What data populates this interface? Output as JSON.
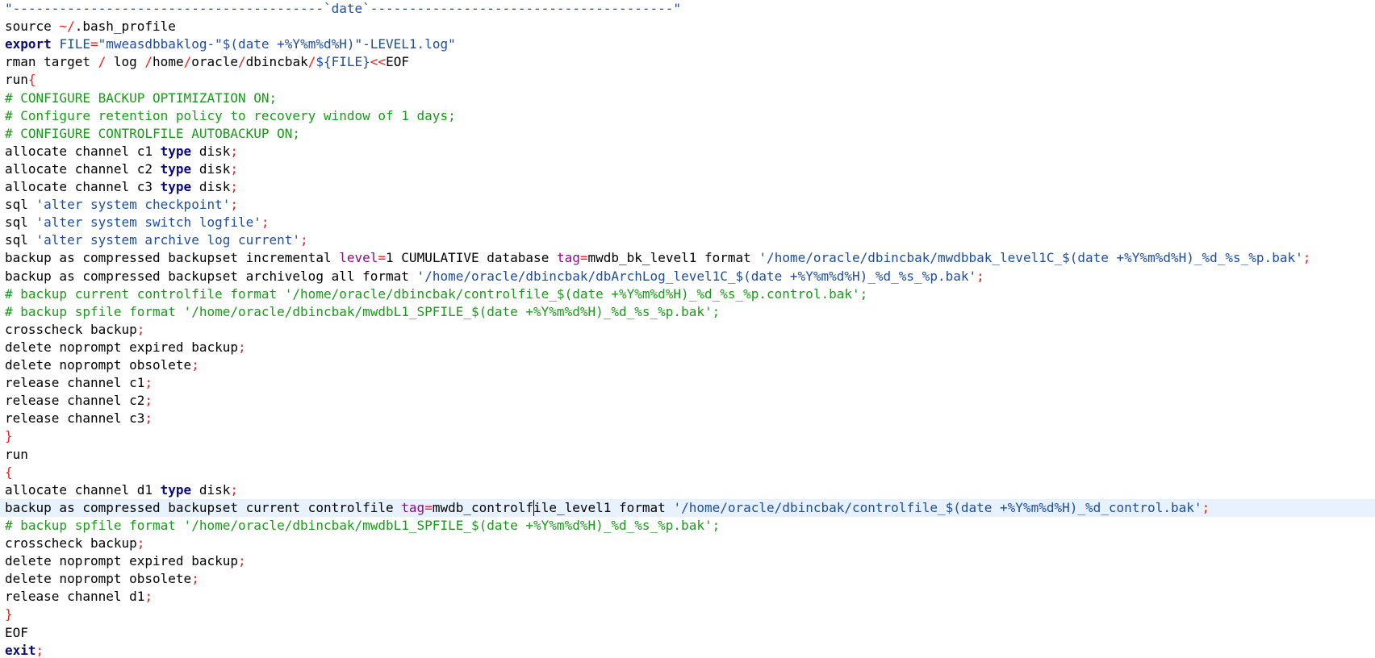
{
  "editor": {
    "colors": {
      "plain": "#000000",
      "operator": "#e8201b",
      "string": "#1d4e9e",
      "keyword": "#0a0a7a",
      "comment": "#1a9a1a",
      "attribute": "#8b0a8b",
      "current_line_bg": "#e8f2fe"
    },
    "current_line_index": 28,
    "lines": [
      [
        [
          "str",
          "\"----------------------------------------`date`---------------------------------------\""
        ]
      ],
      [
        [
          "plain",
          "source "
        ],
        [
          "op",
          "~/"
        ],
        [
          "plain",
          ".bash_profile"
        ]
      ],
      [
        [
          "kw",
          "export"
        ],
        [
          "plain",
          " "
        ],
        [
          "var",
          "FILE"
        ],
        [
          "op",
          "="
        ],
        [
          "str",
          "\"mweasdbbaklog-\"$(date +%Y%m%d%H)\"-LEVEL1.log\""
        ]
      ],
      [
        [
          "plain",
          "rman target "
        ],
        [
          "op",
          "/"
        ],
        [
          "plain",
          " log "
        ],
        [
          "op",
          "/"
        ],
        [
          "plain",
          "home"
        ],
        [
          "op",
          "/"
        ],
        [
          "plain",
          "oracle"
        ],
        [
          "op",
          "/"
        ],
        [
          "plain",
          "dbincbak"
        ],
        [
          "op",
          "/"
        ],
        [
          "var",
          "${FILE}"
        ],
        [
          "op",
          "<<"
        ],
        [
          "plain",
          "EOF"
        ]
      ],
      [
        [
          "plain",
          "run"
        ],
        [
          "op",
          "{"
        ]
      ],
      [
        [
          "cmt",
          "# CONFIGURE BACKUP OPTIMIZATION ON;"
        ]
      ],
      [
        [
          "cmt",
          "# Configure retention policy to recovery window of 1 days;"
        ]
      ],
      [
        [
          "cmt",
          "# CONFIGURE CONTROLFILE AUTOBACKUP ON;"
        ]
      ],
      [
        [
          "plain",
          "allocate channel c1 "
        ],
        [
          "kw",
          "type"
        ],
        [
          "plain",
          " disk"
        ],
        [
          "op",
          ";"
        ]
      ],
      [
        [
          "plain",
          "allocate channel c2 "
        ],
        [
          "kw",
          "type"
        ],
        [
          "plain",
          " disk"
        ],
        [
          "op",
          ";"
        ]
      ],
      [
        [
          "plain",
          "allocate channel c3 "
        ],
        [
          "kw",
          "type"
        ],
        [
          "plain",
          " disk"
        ],
        [
          "op",
          ";"
        ]
      ],
      [
        [
          "plain",
          "sql "
        ],
        [
          "str",
          "'alter system checkpoint'"
        ],
        [
          "op",
          ";"
        ]
      ],
      [
        [
          "plain",
          "sql "
        ],
        [
          "str",
          "'alter system switch logfile'"
        ],
        [
          "op",
          ";"
        ]
      ],
      [
        [
          "plain",
          "sql "
        ],
        [
          "str",
          "'alter system archive log current'"
        ],
        [
          "op",
          ";"
        ]
      ],
      [
        [
          "plain",
          "backup as compressed backupset incremental "
        ],
        [
          "tagkw",
          "level"
        ],
        [
          "op",
          "="
        ],
        [
          "plain",
          "1 CUMULATIVE database "
        ],
        [
          "tagkw",
          "tag"
        ],
        [
          "op",
          "="
        ],
        [
          "plain",
          "mwdb_bk_level1 format "
        ],
        [
          "str",
          "'/home/oracle/dbincbak/mwdbbak_level1C_$(date +%Y%m%d%H)_%d_%s_%p.bak'"
        ],
        [
          "op",
          ";"
        ]
      ],
      [
        [
          "plain",
          "backup as compressed backupset archivelog all format "
        ],
        [
          "str",
          "'/home/oracle/dbincbak/dbArchLog_level1C_$(date +%Y%m%d%H)_%d_%s_%p.bak'"
        ],
        [
          "op",
          ";"
        ]
      ],
      [
        [
          "cmt",
          "# backup current controlfile format '/home/oracle/dbincbak/controlfile_$(date +%Y%m%d%H)_%d_%s_%p.control.bak';"
        ]
      ],
      [
        [
          "cmt",
          "# backup spfile format '/home/oracle/dbincbak/mwdbL1_SPFILE_$(date +%Y%m%d%H)_%d_%s_%p.bak';"
        ]
      ],
      [
        [
          "plain",
          "crosscheck backup"
        ],
        [
          "op",
          ";"
        ]
      ],
      [
        [
          "plain",
          "delete noprompt expired backup"
        ],
        [
          "op",
          ";"
        ]
      ],
      [
        [
          "plain",
          "delete noprompt obsolete"
        ],
        [
          "op",
          ";"
        ]
      ],
      [
        [
          "plain",
          "release channel c1"
        ],
        [
          "op",
          ";"
        ]
      ],
      [
        [
          "plain",
          "release channel c2"
        ],
        [
          "op",
          ";"
        ]
      ],
      [
        [
          "plain",
          "release channel c3"
        ],
        [
          "op",
          ";"
        ]
      ],
      [
        [
          "op",
          "}"
        ]
      ],
      [
        [
          "plain",
          "run"
        ]
      ],
      [
        [
          "op",
          "{"
        ]
      ],
      [
        [
          "plain",
          "allocate channel d1 "
        ],
        [
          "kw",
          "type"
        ],
        [
          "plain",
          " disk"
        ],
        [
          "op",
          ";"
        ]
      ],
      [
        [
          "plain",
          "backup as compressed backupset current controlfile "
        ],
        [
          "tagkw",
          "tag"
        ],
        [
          "op",
          "="
        ],
        [
          "plain",
          "mwdb_controlfile_level1 format "
        ],
        [
          "str",
          "'/home/oracle/dbincbak/controlfile_$(date +%Y%m%d%H)_%d_control.bak'"
        ],
        [
          "op",
          ";"
        ]
      ],
      [
        [
          "cmt",
          "# backup spfile format '/home/oracle/dbincbak/mwdbL1_SPFILE_$(date +%Y%m%d%H)_%d_%s_%p.bak';"
        ]
      ],
      [
        [
          "plain",
          "crosscheck backup"
        ],
        [
          "op",
          ";"
        ]
      ],
      [
        [
          "plain",
          "delete noprompt expired backup"
        ],
        [
          "op",
          ";"
        ]
      ],
      [
        [
          "plain",
          "delete noprompt obsolete"
        ],
        [
          "op",
          ";"
        ]
      ],
      [
        [
          "plain",
          "release channel d1"
        ],
        [
          "op",
          ";"
        ]
      ],
      [
        [
          "op",
          "}"
        ]
      ],
      [
        [
          "plain",
          "EOF"
        ]
      ],
      [
        [
          "kw",
          "exit"
        ],
        [
          "op",
          ";"
        ]
      ]
    ]
  }
}
